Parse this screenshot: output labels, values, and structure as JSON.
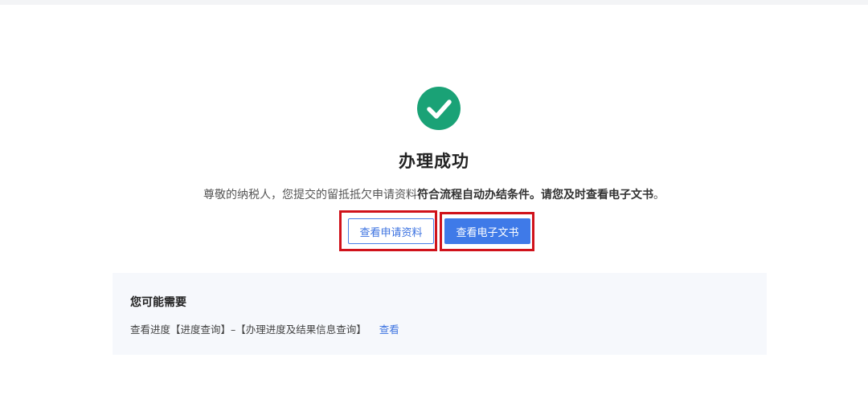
{
  "result": {
    "title": "办理成功",
    "message_normal": "尊敬的纳税人，您提交的留抵抵欠申请资料",
    "message_bold": "符合流程自动办结条件。请您及时查看电子文书",
    "message_end": "。",
    "status_color": "#1aa276"
  },
  "actions": {
    "view_application_label": "查看申请资料",
    "view_document_label": "查看电子文书"
  },
  "suggestions": {
    "title": "您可能需要",
    "item_text": "查看进度【进度查询】–【办理进度及结果信息查询】",
    "item_link": "查看"
  },
  "colors": {
    "accent": "#3f7ae8",
    "highlight": "#d0121b",
    "success": "#1aa276"
  },
  "icons": {
    "status": "check-circle-icon"
  }
}
